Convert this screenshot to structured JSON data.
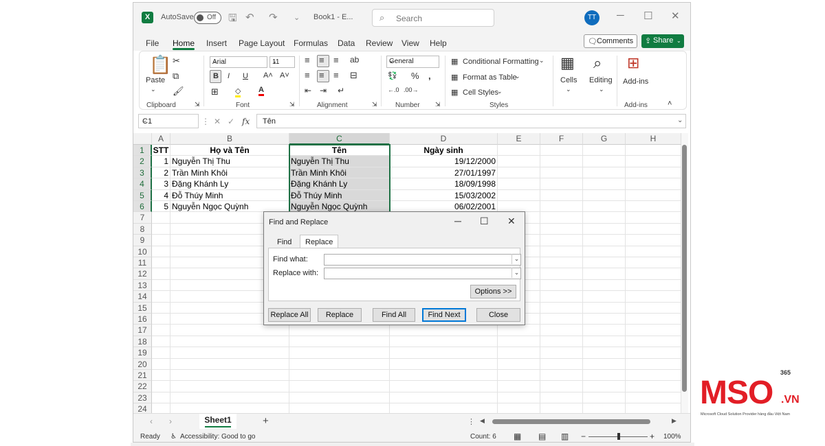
{
  "titlebar": {
    "autosave_label": "AutoSave",
    "autosave_state": "Off",
    "workbook": "Book1 - E...",
    "search_placeholder": "Search",
    "user_initials": "TT"
  },
  "menu": {
    "tabs": [
      "File",
      "Home",
      "Insert",
      "Page Layout",
      "Formulas",
      "Data",
      "Review",
      "View",
      "Help"
    ],
    "active": "Home",
    "comments": "Comments",
    "share": "Share"
  },
  "ribbon": {
    "clipboard": {
      "label": "Clipboard",
      "paste": "Paste"
    },
    "font": {
      "label": "Font",
      "name": "Arial",
      "size": "11",
      "bold": "B",
      "italic": "I",
      "underline": "U"
    },
    "alignment": {
      "label": "Alignment"
    },
    "number": {
      "label": "Number",
      "format": "General"
    },
    "styles": {
      "label": "Styles",
      "conditional": "Conditional Formatting",
      "format_table": "Format as Table",
      "cell_styles": "Cell Styles"
    },
    "cells": {
      "label": "Cells"
    },
    "editing": {
      "label": "Editing"
    },
    "addins": {
      "label": "Add-ins",
      "button": "Add-ins"
    }
  },
  "formula_bar": {
    "name_box": "C1",
    "fx": "fx",
    "content": "Tên"
  },
  "grid": {
    "columns": [
      "A",
      "B",
      "C",
      "D",
      "E",
      "F",
      "G",
      "H"
    ],
    "selected_column": "C",
    "rows": [
      "1",
      "2",
      "3",
      "4",
      "5",
      "6",
      "7",
      "8",
      "9",
      "10",
      "11",
      "12",
      "13",
      "14",
      "15",
      "16",
      "17",
      "18",
      "19",
      "20",
      "21",
      "22",
      "23",
      "24"
    ],
    "header_row": [
      "STT",
      "Họ và Tên",
      "Tên",
      "Ngày sinh"
    ],
    "data": [
      [
        "1",
        "Nguyễn Thị Thu",
        "Nguyễn Thị Thu",
        "19/12/2000"
      ],
      [
        "2",
        "Trần Minh Khôi",
        "Trần Minh Khôi",
        "27/01/1997"
      ],
      [
        "3",
        "Đặng Khánh Ly",
        "Đặng Khánh Ly",
        "18/09/1998"
      ],
      [
        "4",
        "Đỗ Thúy Minh",
        "Đỗ Thúy Minh",
        "15/03/2002"
      ],
      [
        "5",
        "Nguyễn Ngọc Quỳnh",
        "Nguyễn Ngọc Quỳnh",
        "06/02/2001"
      ]
    ]
  },
  "sheets": {
    "active": "Sheet1"
  },
  "status": {
    "ready": "Ready",
    "accessibility": "Accessibility: Good to go",
    "count": "Count: 6",
    "zoom": "100%"
  },
  "dialog": {
    "title": "Find and Replace",
    "tabs": [
      "Find",
      "Replace"
    ],
    "active_tab": "Replace",
    "find_label": "Find what:",
    "replace_label": "Replace with:",
    "find_value": "",
    "replace_value": "",
    "options": "Options >>",
    "buttons": [
      "Replace All",
      "Replace",
      "Find All",
      "Find Next",
      "Close"
    ],
    "default_button": "Find Next"
  },
  "logo": {
    "brand": "MSO",
    "suffix": ".VN",
    "badge": "365",
    "tagline": "Microsoft Cloud Solution Provider hàng đầu Việt Nam"
  },
  "colors": {
    "excel_green": "#107c41",
    "selection": "#1e7145",
    "brand_red": "#e21e26",
    "dialog_focus": "#0078d7"
  }
}
